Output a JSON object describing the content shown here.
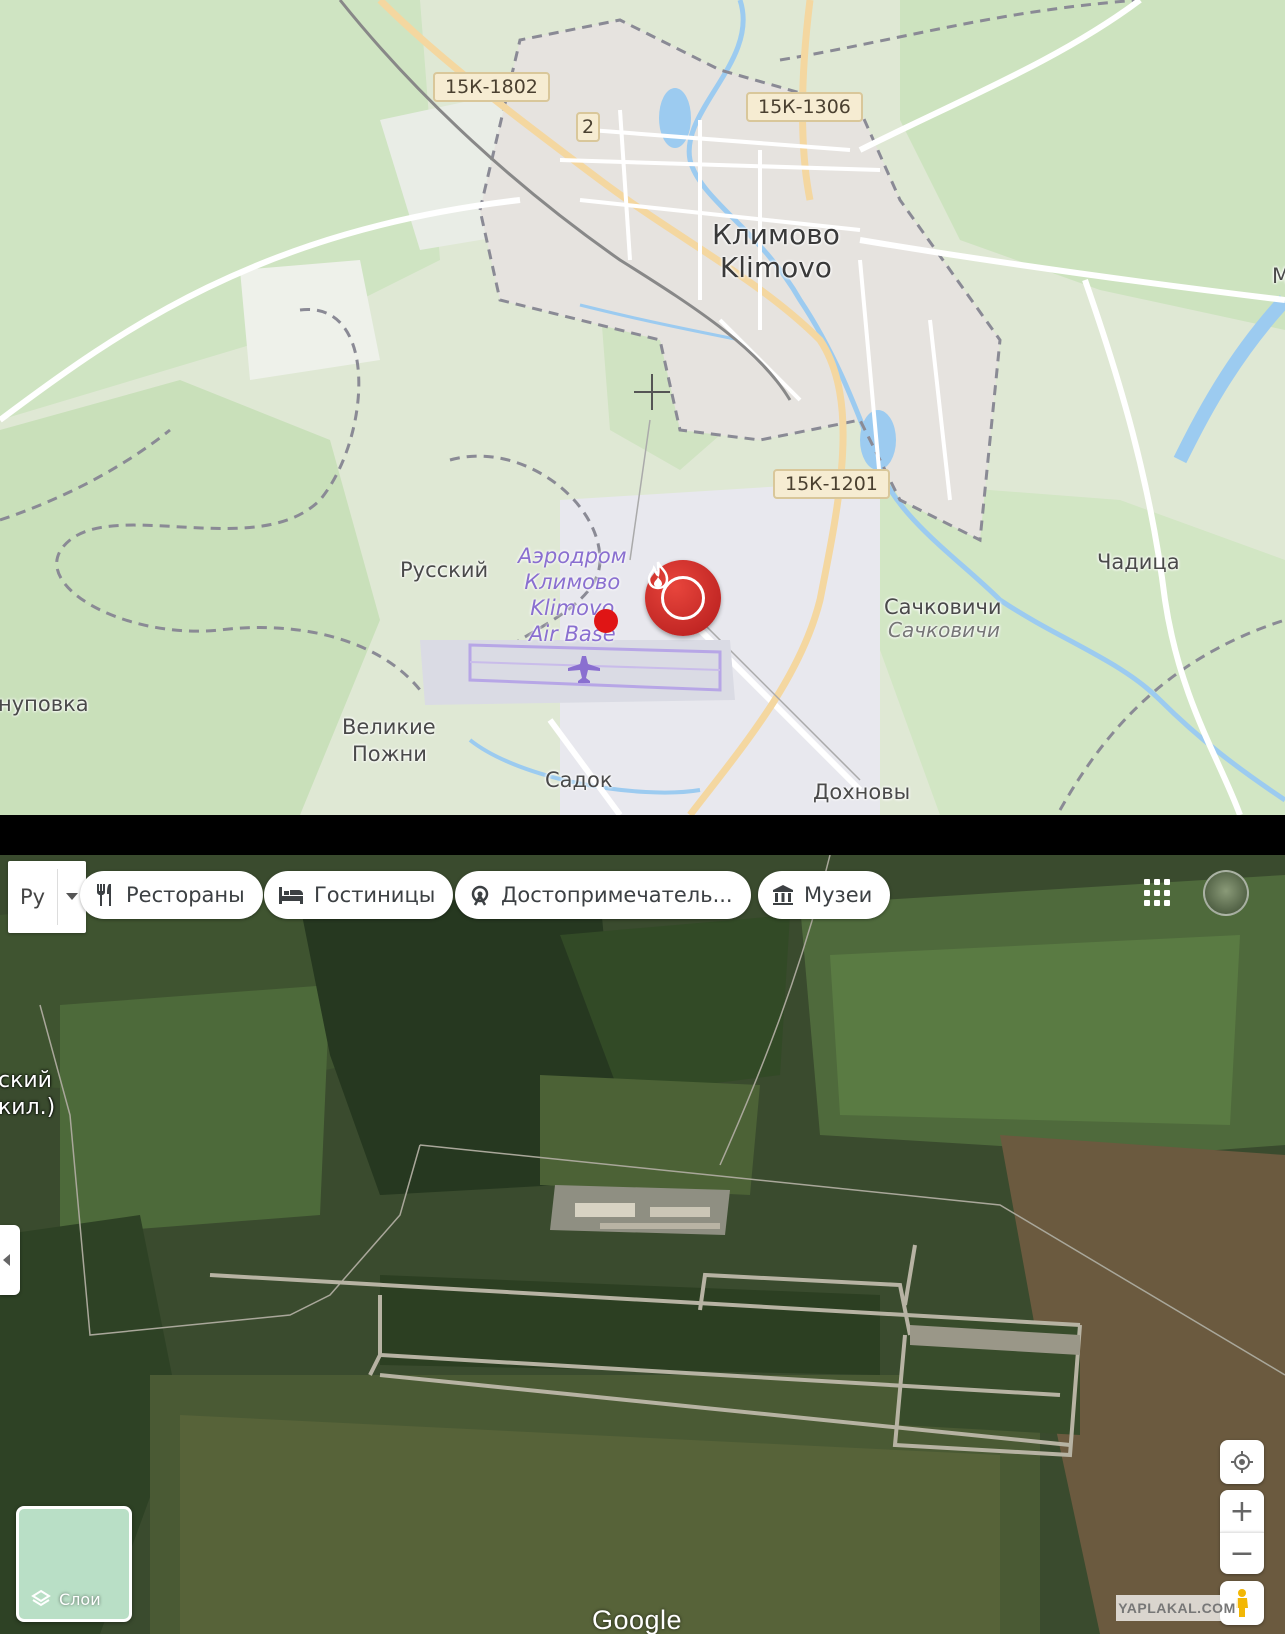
{
  "top_map": {
    "city_ru": "Климово",
    "city_en": "Klimovo",
    "roads": [
      "15К-1802",
      "15К-1306",
      "15К-1201",
      "2"
    ],
    "villages": {
      "russkiy": "Русский",
      "chadica": "Чадица",
      "sachkovichi": "Сачковичи",
      "sachkovichi_sub": "Сачковичи",
      "velikie": "Великие",
      "pozhni": "Пожни",
      "sadok": "Садок",
      "dokhnovy": "Дохновы",
      "chupovka": "нуповка",
      "edge_right": "М"
    },
    "airport_lines": [
      "Аэродром",
      "Климово",
      "Klimovo",
      "Air Base"
    ]
  },
  "sat_map": {
    "lang": "Ру",
    "chips": [
      "Рестораны",
      "Гостиницы",
      "Достопримечатель...",
      "Музеи"
    ],
    "left_label_line1": "ский",
    "left_label_line2": "кил.)",
    "layers_label": "Слои",
    "zoom_in": "+",
    "zoom_out": "−",
    "logo": "Google",
    "watermark": "YAPLAKAL.COM"
  },
  "colors": {
    "fire_marker": "#c62828",
    "red_dot": "#e01515",
    "airport_text": "#8a6fd0"
  },
  "icons": [
    "cutlery-icon",
    "bed-icon",
    "attraction-icon",
    "museum-icon",
    "apps-grid-icon",
    "fire-icon",
    "plane-icon",
    "layers-icon",
    "locate-icon",
    "pegman-icon"
  ]
}
